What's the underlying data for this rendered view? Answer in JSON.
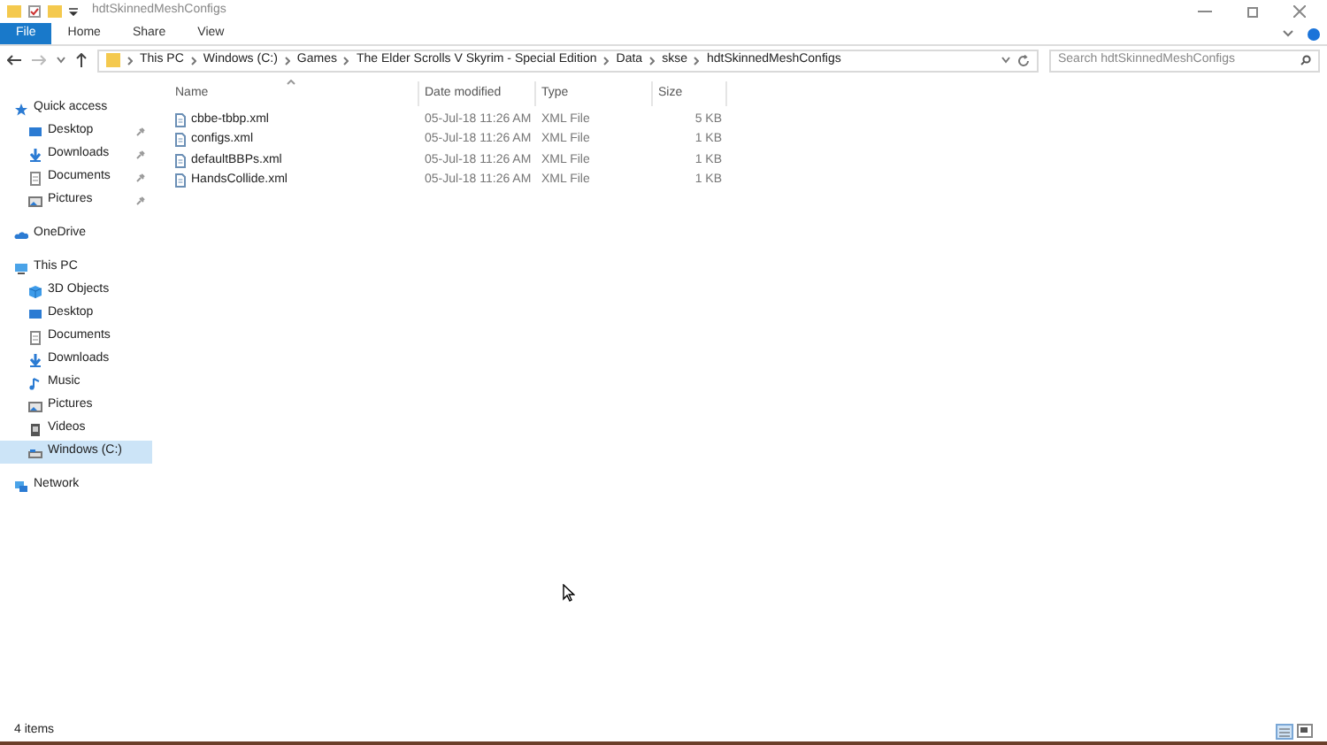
{
  "window": {
    "title": "hdtSkinnedMeshConfigs"
  },
  "ribbon_tabs": [
    {
      "label": "File",
      "selected": true
    },
    {
      "label": "Home",
      "selected": false
    },
    {
      "label": "Share",
      "selected": false
    },
    {
      "label": "View",
      "selected": false
    }
  ],
  "breadcrumb": [
    "This PC",
    "Windows (C:)",
    "Games",
    "The Elder Scrolls V Skyrim - Special Edition",
    "Data",
    "skse",
    "hdtSkinnedMeshConfigs"
  ],
  "search": {
    "placeholder": "Search hdtSkinnedMeshConfigs"
  },
  "sidebar": {
    "items": [
      {
        "label": "Quick access",
        "kind": "star",
        "selected": false,
        "children": [
          {
            "label": "Desktop",
            "kind": "desktop",
            "pinned": true,
            "selected": false
          },
          {
            "label": "Downloads",
            "kind": "download",
            "pinned": true,
            "selected": false
          },
          {
            "label": "Documents",
            "kind": "document",
            "pinned": true,
            "selected": false
          },
          {
            "label": "Pictures",
            "kind": "pictures",
            "pinned": true,
            "selected": false
          }
        ]
      },
      {
        "label": "OneDrive",
        "kind": "cloud",
        "selected": false
      },
      {
        "label": "This PC",
        "kind": "pc",
        "selected": false,
        "children": [
          {
            "label": "3D Objects",
            "kind": "cube",
            "pinned": false,
            "selected": false
          },
          {
            "label": "Desktop",
            "kind": "desktop",
            "pinned": false,
            "selected": false
          },
          {
            "label": "Documents",
            "kind": "document",
            "pinned": false,
            "selected": false
          },
          {
            "label": "Downloads",
            "kind": "download",
            "pinned": false,
            "selected": false
          },
          {
            "label": "Music",
            "kind": "music",
            "pinned": false,
            "selected": false
          },
          {
            "label": "Pictures",
            "kind": "pictures",
            "pinned": false,
            "selected": false
          },
          {
            "label": "Videos",
            "kind": "video",
            "pinned": false,
            "selected": false
          },
          {
            "label": "Windows (C:)",
            "kind": "drive",
            "pinned": false,
            "selected": true
          }
        ]
      },
      {
        "label": "Network",
        "kind": "network",
        "selected": false
      }
    ]
  },
  "table": {
    "columns": [
      "Name",
      "Date modified",
      "Type",
      "Size"
    ],
    "rows": [
      {
        "name": "cbbe-tbbp.xml",
        "date": "05-Jul-18 11:26 AM",
        "type": "XML File",
        "size": "5 KB"
      },
      {
        "name": "configs.xml",
        "date": "05-Jul-18 11:26 AM",
        "type": "XML File",
        "size": "1 KB"
      },
      {
        "name": "defaultBBPs.xml",
        "date": "05-Jul-18 11:26 AM",
        "type": "XML File",
        "size": "1 KB"
      },
      {
        "name": "HandsCollide.xml",
        "date": "05-Jul-18 11:26 AM",
        "type": "XML File",
        "size": "1 KB"
      }
    ]
  },
  "status_bar": {
    "text": "4 items"
  }
}
